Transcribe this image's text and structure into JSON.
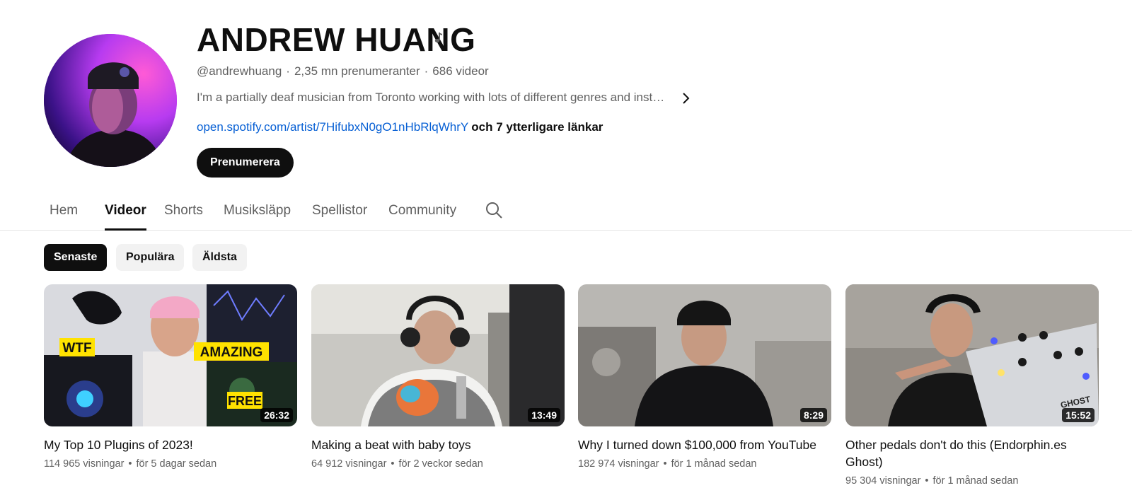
{
  "channel": {
    "name": "ANDREW HUANG",
    "handle": "@andrewhuang",
    "subscribers": "2,35 mn prenumeranter",
    "video_count": "686 videor",
    "description": "I'm a partially deaf musician from Toronto working with lots of different genres and instruments.",
    "link": "open.spotify.com/artist/7HifubxN0gO1nHbRlqWhrY",
    "more_links": "och 7 ytterligare länkar",
    "subscribe_label": "Prenumerera"
  },
  "tabs": [
    {
      "label": "Hem"
    },
    {
      "label": "Videor",
      "active": true
    },
    {
      "label": "Shorts"
    },
    {
      "label": "Musiksläpp"
    },
    {
      "label": "Spellistor"
    },
    {
      "label": "Community"
    }
  ],
  "chips": [
    {
      "label": "Senaste",
      "active": true
    },
    {
      "label": "Populära"
    },
    {
      "label": "Äldsta"
    }
  ],
  "videos": [
    {
      "title": "My Top 10 Plugins of 2023!",
      "duration": "26:32",
      "views": "114 965 visningar",
      "age": "för 5 dagar sedan"
    },
    {
      "title": "Making a beat with baby toys",
      "duration": "13:49",
      "views": "64 912 visningar",
      "age": "för 2 veckor sedan"
    },
    {
      "title": "Why I turned down $100,000 from YouTube",
      "duration": "8:29",
      "views": "182 974 visningar",
      "age": "för 1 månad sedan"
    },
    {
      "title": "Other pedals don't do this (Endorphin.es Ghost)",
      "duration": "15:52",
      "views": "95 304 visningar",
      "age": "för 1 månad sedan"
    }
  ],
  "thumb_text": {
    "v1_wtf": "WTF",
    "v1_amazing": "AMAZING",
    "v1_free": "FREE",
    "v4_ghost": "GHOST"
  },
  "colors": {
    "accent_link": "#065fd4",
    "text_primary": "#0f0f0f",
    "text_secondary": "#606060",
    "chip_bg": "#f2f2f2"
  },
  "icons": {
    "verified": "music-note-icon",
    "expand": "chevron-right-icon",
    "search": "search-icon"
  }
}
